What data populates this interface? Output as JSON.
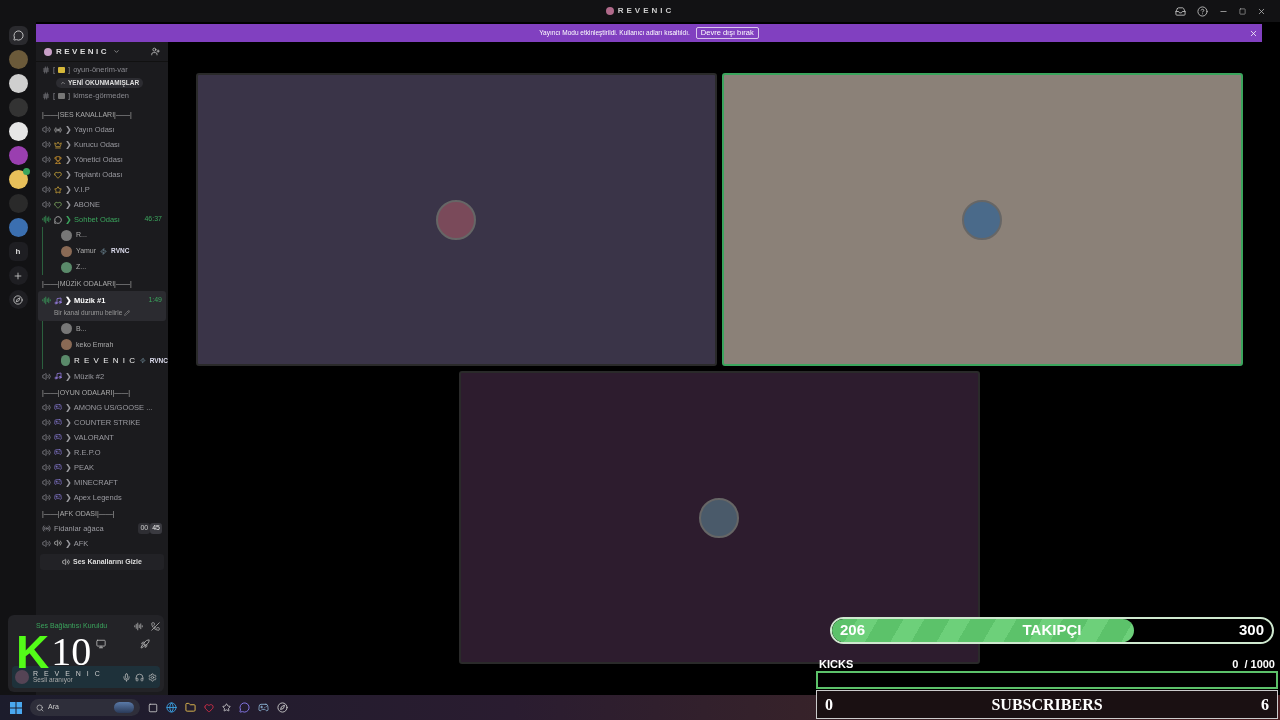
{
  "window": {
    "title": "REVENIC"
  },
  "banner": {
    "message": "Yayıncı Modu etkinleştirildi. Kullanıcı adları kısaltıldı.",
    "button": "Devre dışı bırak"
  },
  "servers": [
    {
      "kind": "home"
    },
    {
      "kind": "server"
    },
    {
      "kind": "server"
    },
    {
      "kind": "server"
    },
    {
      "kind": "server"
    },
    {
      "kind": "server"
    },
    {
      "kind": "server"
    },
    {
      "kind": "server"
    },
    {
      "kind": "server"
    },
    {
      "kind": "letter",
      "label": "h"
    },
    {
      "kind": "add"
    },
    {
      "kind": "discover"
    }
  ],
  "sidebar": {
    "server_name": "REVENIC",
    "tooltip": "YENİ OKUNMAMIŞLAR",
    "text_channels": [
      {
        "bracket_open": "[",
        "bracket_close": "]",
        "name": "oyun-önerim-var"
      },
      {
        "bracket_open": "[",
        "bracket_close": "]",
        "name": "kimse-görmeden"
      }
    ],
    "categories": [
      {
        "label": "|——|SES KANALLARI|——|",
        "channels": [
          {
            "kind": "voice",
            "name": "❯ Yayın Odası",
            "connected": false,
            "selected": false
          },
          {
            "kind": "voice",
            "name": "❯ Kurucu Odası",
            "connected": false,
            "selected": false
          },
          {
            "kind": "voice",
            "name": "❯ Yönetici Odası",
            "connected": false,
            "selected": false
          },
          {
            "kind": "voice",
            "name": "❯ Toplantı Odası",
            "connected": false,
            "selected": false
          },
          {
            "kind": "voice",
            "name": "❯ V.I.P",
            "connected": false,
            "selected": false
          },
          {
            "kind": "voice",
            "name": "❯ ABONE",
            "connected": false,
            "selected": false
          },
          {
            "kind": "voice",
            "name": "❯ Sohbet Odası",
            "connected": true,
            "selected": false,
            "timer": "46:37",
            "users": [
              {
                "name": "R..."
              },
              {
                "name": "Yamur",
                "badge": "RVNC"
              },
              {
                "name": "Z..."
              }
            ]
          }
        ]
      },
      {
        "label": "|——|MÜZİK ODALARI|——|",
        "channels": [
          {
            "kind": "voice",
            "name": "❯ Müzik #1",
            "connected": true,
            "selected": true,
            "timer": "1:49",
            "status": "Bir kanal durumu belirle",
            "users": [
              {
                "name": "B..."
              },
              {
                "name": "keko Emrah"
              },
              {
                "name": "R E V E N I C",
                "badge": "RVNC"
              }
            ]
          },
          {
            "kind": "voice",
            "name": "❯ Müzik #2",
            "connected": false,
            "selected": false
          }
        ]
      },
      {
        "label": "|——|OYUN ODALARI|——|",
        "channels": [
          {
            "kind": "voice",
            "name": "❯ AMONG US/GOOSE ...",
            "connected": false,
            "selected": false
          },
          {
            "kind": "voice",
            "name": "❯ COUNTER STRIKE",
            "connected": false,
            "selected": false
          },
          {
            "kind": "voice",
            "name": "❯ VALORANT",
            "connected": false,
            "selected": false
          },
          {
            "kind": "voice",
            "name": "❯ R.E.P.O",
            "connected": false,
            "selected": false
          },
          {
            "kind": "voice",
            "name": "❯ PEAK",
            "connected": false,
            "selected": false
          },
          {
            "kind": "voice",
            "name": "❯ MINECRAFT",
            "connected": false,
            "selected": false
          },
          {
            "kind": "voice",
            "name": "❯ Apex Legends",
            "connected": false,
            "selected": false
          }
        ]
      },
      {
        "label": "|——|AFK ODASI|——|",
        "channels": [
          {
            "kind": "stage",
            "name": "Fidanlar ağaca",
            "connected": false,
            "selected": false,
            "counts": [
              "00",
              "45"
            ]
          },
          {
            "kind": "voice",
            "name": "❯ AFK",
            "connected": false,
            "selected": false
          }
        ]
      }
    ],
    "hide_button": "Ses Kanallarını Gizle"
  },
  "voice_panel": {
    "status": "Ses Bağlantısı Kuruldu",
    "user": "R E V E N I C",
    "user_status": "Sesli aranıyor"
  },
  "tiles": [
    {
      "speaking": false
    },
    {
      "speaking": true
    },
    {
      "speaking": false
    }
  ],
  "overlay": {
    "logo": "K",
    "count": "10",
    "followers": {
      "current": "206",
      "label": "TAKIPÇI",
      "goal": "300",
      "level": 0.687
    },
    "kicks": {
      "label": "KICKS",
      "count": "0  / 1000",
      "level": 0
    },
    "subscribers": {
      "current": "0",
      "label": "SUBSCRIBERS",
      "goal": "6"
    }
  },
  "taskbar": {
    "search": "Ara"
  }
}
